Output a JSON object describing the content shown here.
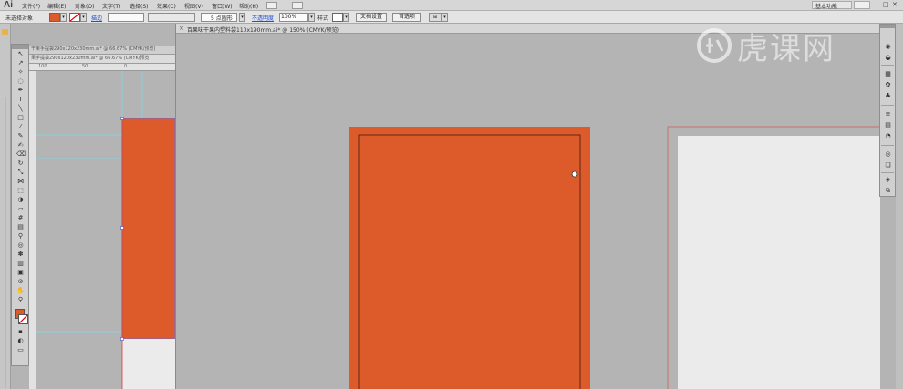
{
  "app": {
    "logo": "Ai",
    "menus": [
      "文件(F)",
      "编辑(E)",
      "对象(O)",
      "文字(T)",
      "选择(S)",
      "效果(C)",
      "视图(V)",
      "窗口(W)",
      "帮助(H)"
    ],
    "workspace": "基本功能",
    "window_buttons": [
      "–",
      "□",
      "✕"
    ]
  },
  "control_bar": {
    "selection_status": "未选择对象",
    "stroke_label": "描边",
    "stroke_weight": "",
    "brush_label": "5 点圆形",
    "opacity_label": "不透明度",
    "opacity_value": "100%",
    "style_label": "样式",
    "doc_setup_button": "文档设置",
    "preferences_button": "首选项"
  },
  "documents": {
    "back_tab_1": "干果手提袋290x120x230mm.ai* @ 66.67% (CMYK/预览)",
    "back_tab_2": "果手提袋290x120x230mm.ai* @ 66.67% (CMYK/预览",
    "back_ruler_marks": [
      "100",
      "50",
      "0"
    ],
    "front_tab": "百果味干果内塑料袋110x190mm.ai* @ 150% (CMYK/预览)",
    "front_close": "×"
  },
  "watermark": {
    "text": "虎课网"
  },
  "colors": {
    "orange_fill": "#dd5a2a",
    "canvas_gray": "#b4b4b4",
    "artboard_white": "#ebebeb",
    "guide_cyan": "#7fd8e8"
  },
  "icons": {
    "tools": [
      "selection-arrow-icon",
      "direct-selection-icon",
      "magic-wand-icon",
      "lasso-icon",
      "pen-icon",
      "type-icon",
      "line-icon",
      "rectangle-icon",
      "paintbrush-icon",
      "pencil-icon",
      "blob-brush-icon",
      "eraser-icon",
      "rotate-icon",
      "scale-icon",
      "width-icon",
      "free-transform-icon",
      "shape-builder-icon",
      "perspective-icon",
      "mesh-icon",
      "gradient-icon",
      "eyedropper-icon",
      "blend-icon",
      "symbol-sprayer-icon",
      "column-graph-icon",
      "artboard-icon",
      "slice-icon",
      "hand-icon",
      "zoom-icon"
    ],
    "panels": [
      "color-panel-icon",
      "color-guide-icon",
      "swatches-icon",
      "brushes-icon",
      "symbols-icon",
      "stroke-icon",
      "gradient-panel-icon",
      "transparency-icon",
      "appearance-icon",
      "graphic-styles-icon",
      "layers-icon",
      "artboards-icon"
    ]
  }
}
